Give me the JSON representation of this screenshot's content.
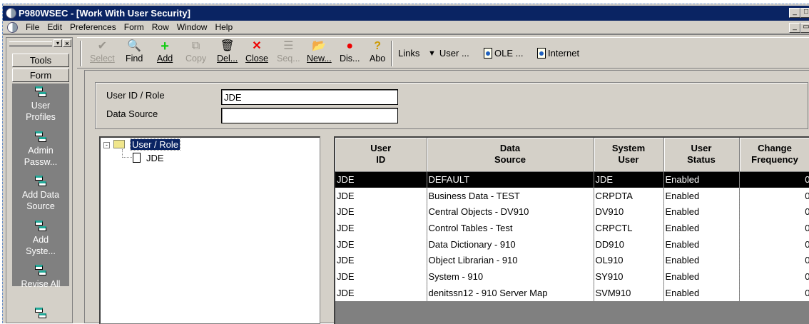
{
  "window": {
    "title": "P980WSEC - [Work With User Security]"
  },
  "menu": [
    "File",
    "Edit",
    "Preferences",
    "Form",
    "Row",
    "Window",
    "Help"
  ],
  "left_panel": {
    "tabs": [
      "Tools",
      "Form"
    ],
    "items": [
      "User\nProfiles",
      "Admin\nPassw...",
      "Add Data\nSource",
      "Add\nSyste...",
      "Revise All",
      ""
    ]
  },
  "toolbar": {
    "buttons": [
      {
        "label": "Select",
        "icon": "check-icon",
        "enabled": false
      },
      {
        "label": "Find",
        "icon": "find-icon",
        "enabled": true
      },
      {
        "label": "Add",
        "icon": "plus-icon",
        "enabled": true
      },
      {
        "label": "Copy",
        "icon": "copy-icon",
        "enabled": false
      },
      {
        "label": "Del...",
        "icon": "trash-icon",
        "enabled": true
      },
      {
        "label": "Close",
        "icon": "close-icon",
        "enabled": true
      },
      {
        "label": "Seq...",
        "icon": "sequence-icon",
        "enabled": false
      },
      {
        "label": "New...",
        "icon": "new-folder-icon",
        "enabled": true
      },
      {
        "label": "Dis...",
        "icon": "display-icon",
        "enabled": true
      },
      {
        "label": "Abo",
        "icon": "about-icon",
        "enabled": true
      }
    ],
    "links_label": "Links",
    "links": [
      "User ...",
      "OLE ...",
      "Internet"
    ]
  },
  "form": {
    "user_id_label": "User ID / Role",
    "user_id_value": "JDE",
    "data_source_label": "Data Source",
    "data_source_value": ""
  },
  "tree": {
    "root": "User / Role",
    "children": [
      "JDE"
    ]
  },
  "grid": {
    "columns": [
      "User\nID",
      "Data\nSource",
      "System\nUser",
      "User\nStatus",
      "Change\nFrequency"
    ],
    "rows": [
      [
        "JDE",
        "DEFAULT",
        "JDE",
        "Enabled",
        "0"
      ],
      [
        "JDE",
        "Business Data - TEST",
        "CRPDTA",
        "Enabled",
        "0"
      ],
      [
        "JDE",
        "Central Objects - DV910",
        "DV910",
        "Enabled",
        "0"
      ],
      [
        "JDE",
        "Control Tables - Test",
        "CRPCTL",
        "Enabled",
        "0"
      ],
      [
        "JDE",
        "Data Dictionary - 910",
        "DD910",
        "Enabled",
        "0"
      ],
      [
        "JDE",
        "Object Librarian - 910",
        "OL910",
        "Enabled",
        "0"
      ],
      [
        "JDE",
        "System - 910",
        "SY910",
        "Enabled",
        "0"
      ],
      [
        "JDE",
        "denitssn12 - 910 Server Map",
        "SVM910",
        "Enabled",
        "0"
      ]
    ],
    "selected_row": 0
  }
}
